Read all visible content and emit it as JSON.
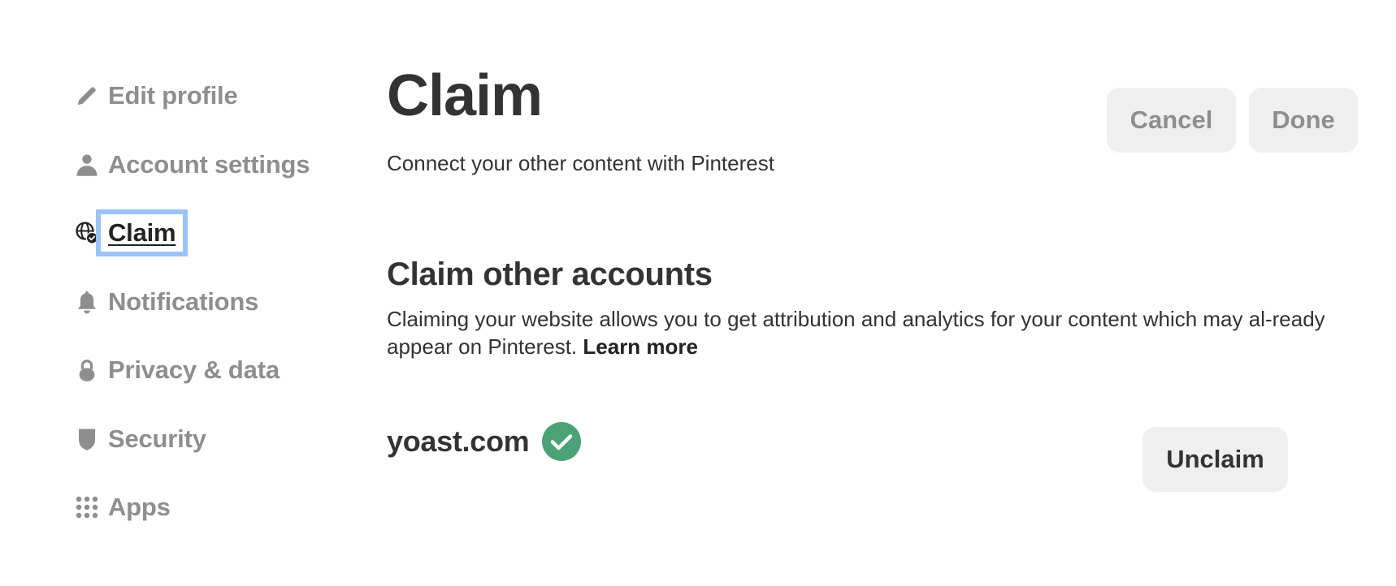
{
  "sidebar": {
    "items": [
      {
        "label": "Edit profile",
        "icon": "pencil-icon",
        "active": false
      },
      {
        "label": "Account settings",
        "icon": "person-icon",
        "active": false
      },
      {
        "label": "Claim",
        "icon": "globe-check-icon",
        "active": true
      },
      {
        "label": "Notifications",
        "icon": "bell-icon",
        "active": false
      },
      {
        "label": "Privacy & data",
        "icon": "lock-icon",
        "active": false
      },
      {
        "label": "Security",
        "icon": "shield-icon",
        "active": false
      },
      {
        "label": "Apps",
        "icon": "grid-dots-icon",
        "active": false
      }
    ]
  },
  "header": {
    "title": "Claim",
    "subtitle": "Connect your other content with Pinterest",
    "cancel_label": "Cancel",
    "done_label": "Done"
  },
  "claim_section": {
    "title": "Claim other accounts",
    "description": "Claiming your website allows you to get attribution and analytics for your content which may al-ready appear on Pinterest.",
    "learn_more_label": "Learn more"
  },
  "claimed_accounts": [
    {
      "site": "yoast.com",
      "status": "verified",
      "action_label": "Unclaim"
    }
  ],
  "colors": {
    "verified_green": "#4aa276",
    "focus_ring": "#9dc2f7",
    "muted_text": "#8e8e8e",
    "button_bg": "#efefef"
  }
}
